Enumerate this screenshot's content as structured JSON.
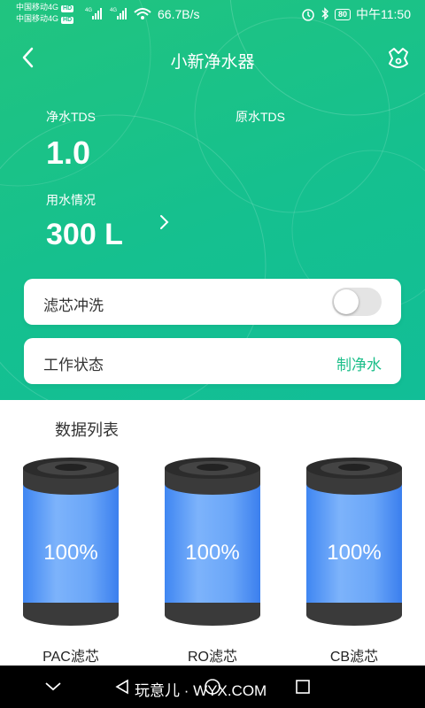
{
  "status_bar": {
    "carrier1": "中国移动4G",
    "carrier2": "中国移动4G",
    "hd1": "HD",
    "hd2": "HD",
    "net_speed": "66.7B/s",
    "battery": "80",
    "time": "中午11:50"
  },
  "header": {
    "title": "小新净水器"
  },
  "tds": {
    "purified_label": "净水TDS",
    "purified_value": "1.0",
    "raw_label": "原水TDS",
    "usage_label": "用水情况",
    "usage_value": "300 L"
  },
  "cards": {
    "flush_label": "滤芯冲洗",
    "flush_on": false,
    "status_label": "工作状态",
    "status_value": "制净水"
  },
  "data_list": {
    "title": "数据列表",
    "filters": [
      {
        "name": "PAC滤芯",
        "percent": "100%"
      },
      {
        "name": "RO滤芯",
        "percent": "100%"
      },
      {
        "name": "CB滤芯",
        "percent": "100%"
      }
    ]
  },
  "nav_bar": {
    "watermark": "玩意儿 · WYX.COM"
  },
  "colors": {
    "accent": "#1cbf8a",
    "filter_blue": "#5b9cf5",
    "filter_cap": "#3a3a3a"
  }
}
